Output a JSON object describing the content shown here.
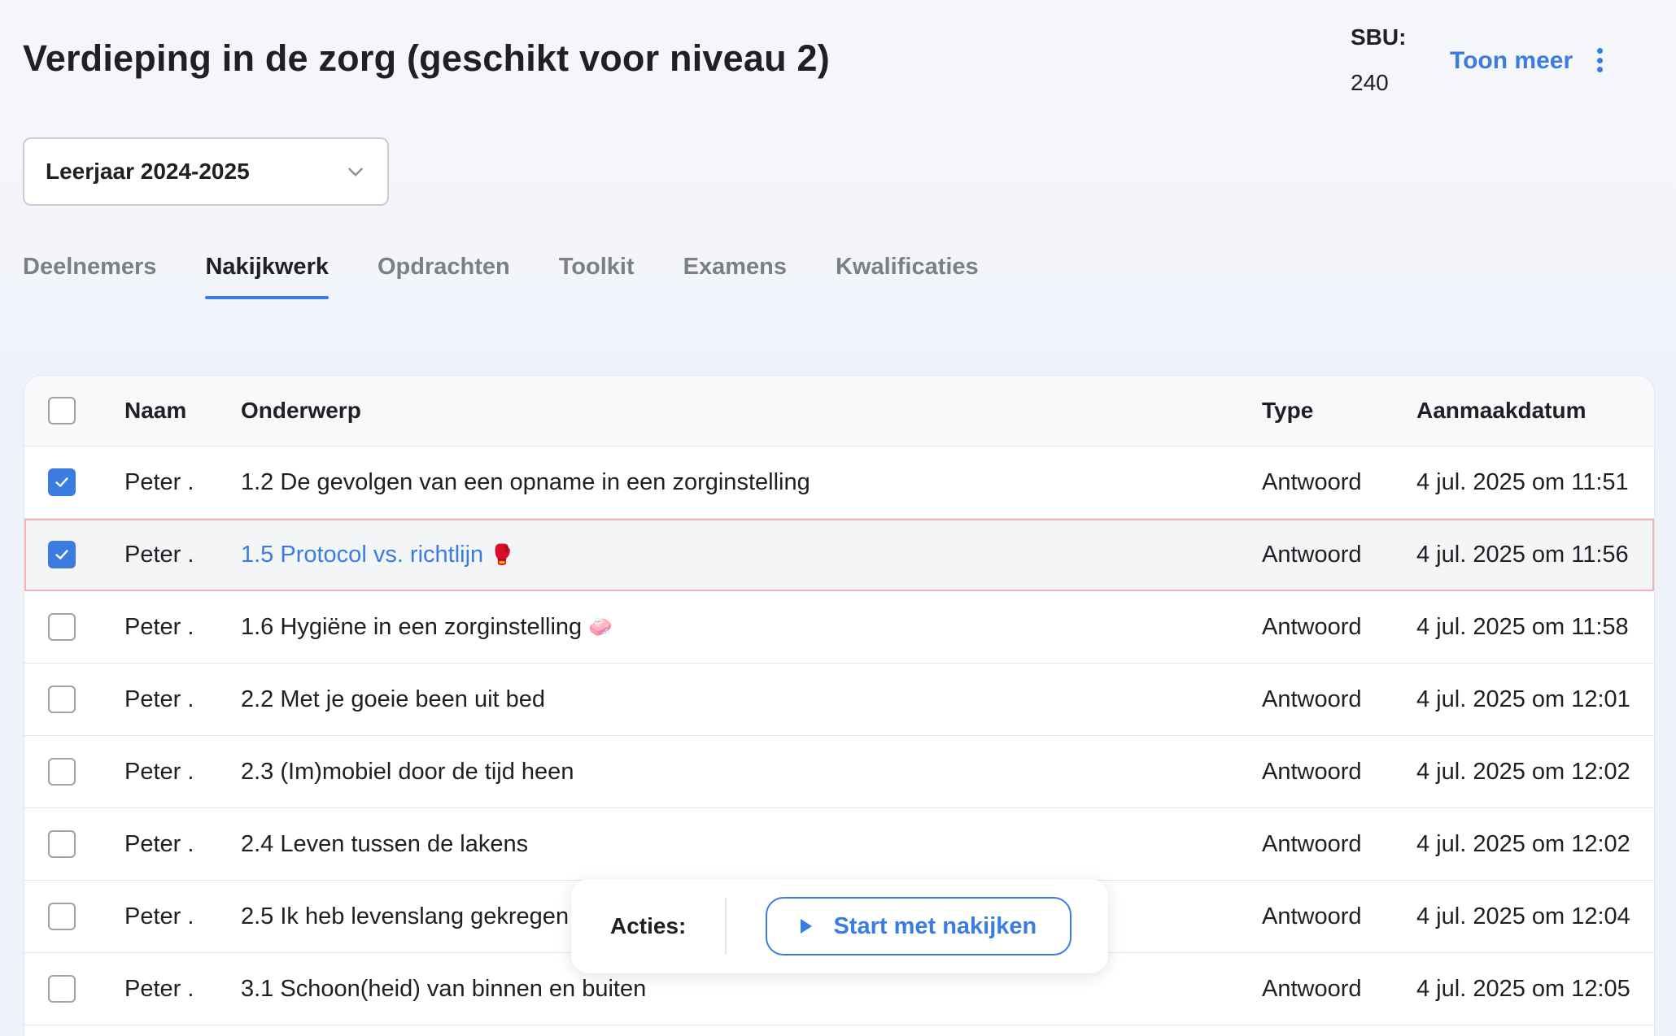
{
  "header": {
    "title": "Verdieping in de zorg (geschikt voor niveau 2)",
    "sbu_label": "SBU:",
    "sbu_value": "240",
    "toon_meer": "Toon meer",
    "menu_icon": "kebab-vertical-icon"
  },
  "year_select": {
    "value": "Leerjaar 2024-2025",
    "icon": "chevron-down-icon"
  },
  "tabs": [
    {
      "label": "Deelnemers",
      "active": false
    },
    {
      "label": "Nakijkwerk",
      "active": true
    },
    {
      "label": "Opdrachten",
      "active": false
    },
    {
      "label": "Toolkit",
      "active": false
    },
    {
      "label": "Examens",
      "active": false
    },
    {
      "label": "Kwalificaties",
      "active": false
    }
  ],
  "table": {
    "columns": {
      "naam": "Naam",
      "onderwerp": "Onderwerp",
      "type": "Type",
      "datum": "Aanmaakdatum"
    },
    "rows": [
      {
        "checked": true,
        "naam": "Peter .",
        "onderwerp": "1.2 De gevolgen van een opname in een zorginstelling",
        "emoji": "",
        "type": "Antwoord",
        "datum": "4 jul. 2025 om 11:51"
      },
      {
        "checked": true,
        "naam": "Peter .",
        "onderwerp": "1.5 Protocol vs. richtlijn",
        "emoji": "🥊",
        "type": "Antwoord",
        "datum": "4 jul. 2025 om 11:56"
      },
      {
        "checked": false,
        "naam": "Peter .",
        "onderwerp": "1.6 Hygiëne in een zorginstelling",
        "emoji": "🧼",
        "type": "Antwoord",
        "datum": "4 jul. 2025 om 11:58"
      },
      {
        "checked": false,
        "naam": "Peter .",
        "onderwerp": "2.2 Met je goeie been uit bed",
        "emoji": "",
        "type": "Antwoord",
        "datum": "4 jul. 2025 om 12:01"
      },
      {
        "checked": false,
        "naam": "Peter .",
        "onderwerp": "2.3 (Im)mobiel door de tijd heen",
        "emoji": "",
        "type": "Antwoord",
        "datum": "4 jul. 2025 om 12:02"
      },
      {
        "checked": false,
        "naam": "Peter .",
        "onderwerp": "2.4 Leven tussen de lakens",
        "emoji": "",
        "type": "Antwoord",
        "datum": "4 jul. 2025 om 12:02"
      },
      {
        "checked": false,
        "naam": "Peter .",
        "onderwerp": "2.5 Ik heb levenslang gekregen",
        "emoji": "",
        "type": "Antwoord",
        "datum": "4 jul. 2025 om 12:04"
      },
      {
        "checked": false,
        "naam": "Peter .",
        "onderwerp": "3.1 Schoon(heid) van binnen en buiten",
        "emoji": "",
        "type": "Antwoord",
        "datum": "4 jul. 2025 om 12:05"
      }
    ]
  },
  "actions": {
    "label": "Acties:",
    "start_button": "Start met nakijken",
    "start_icon": "play-icon"
  },
  "colors": {
    "accent": "#3a7ce0",
    "selected_row_border": "#f2b3b3"
  }
}
